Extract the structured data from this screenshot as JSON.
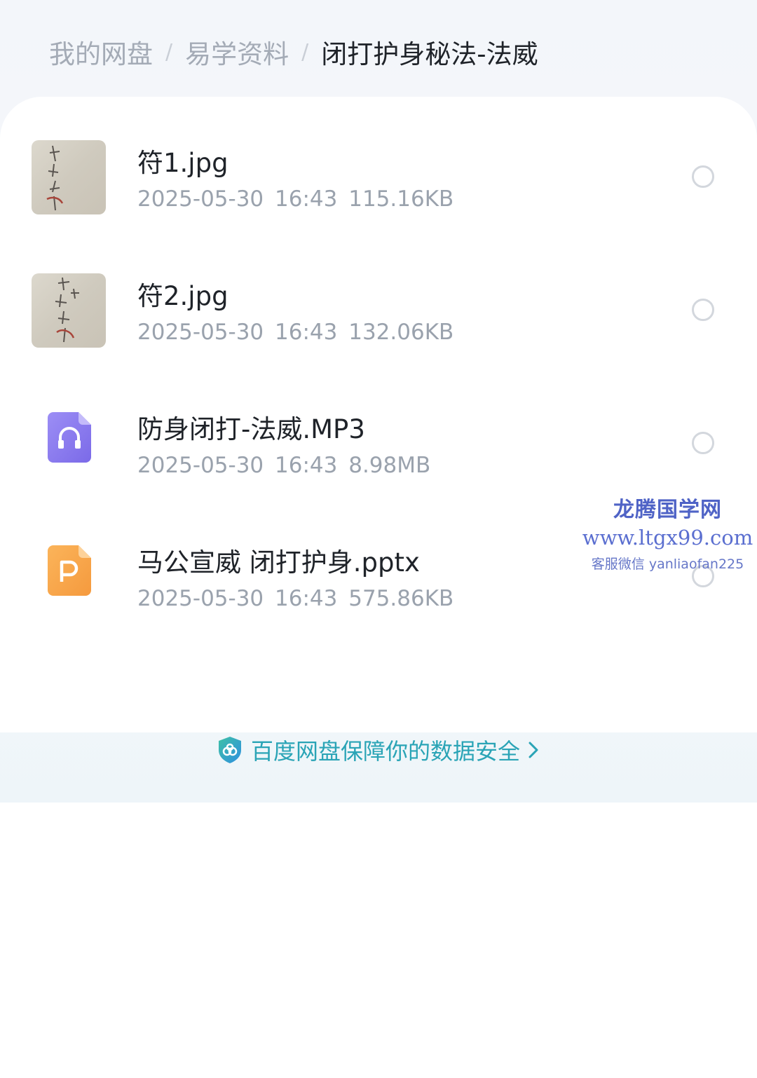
{
  "breadcrumb": {
    "items": [
      "我的网盘",
      "易学资料",
      "闭打护身秘法-法威"
    ],
    "separator": "/"
  },
  "files": [
    {
      "name": "符1.jpg",
      "date": "2025-05-30",
      "time": "16:43",
      "size": "115.16KB",
      "icon": "image-thumbnail"
    },
    {
      "name": "符2.jpg",
      "date": "2025-05-30",
      "time": "16:43",
      "size": "132.06KB",
      "icon": "image-thumbnail"
    },
    {
      "name": "防身闭打-法威.MP3",
      "date": "2025-05-30",
      "time": "16:43",
      "size": "8.98MB",
      "icon": "audio-file-icon"
    },
    {
      "name": "马公宣威 闭打护身.pptx",
      "date": "2025-05-30",
      "time": "16:43",
      "size": "575.86KB",
      "icon": "ppt-file-icon"
    }
  ],
  "watermark": {
    "title": "龙腾国学网",
    "url": "www.ltgx99.com",
    "contact": "客服微信 yanliaofan225"
  },
  "security": {
    "text": "百度网盘保障你的数据安全",
    "icon": "shield-icon"
  },
  "colors": {
    "audio_icon": "#8a7cf0",
    "ppt_icon": "#f7a44a",
    "security_text": "#2aa4b6",
    "watermark": "#4f63c6"
  }
}
